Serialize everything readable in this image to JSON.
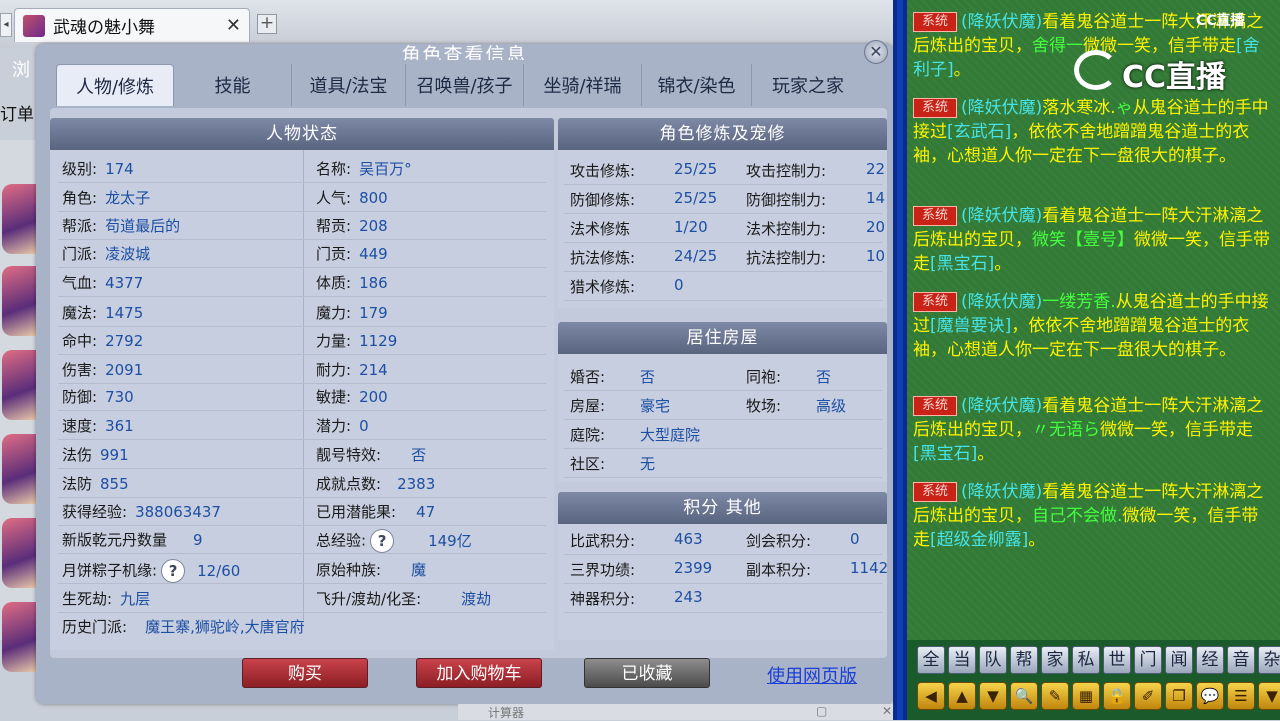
{
  "browser": {
    "tab_title": "武魂の魅小舞",
    "tab_close": "✕",
    "new_tab": "+",
    "menu_glyph": "浏",
    "order_text": "订单"
  },
  "dialog": {
    "title": "角色查看信息",
    "close": "✕",
    "tabs": [
      "人物/修炼",
      "技能",
      "道具/法宝",
      "召唤兽/孩子",
      "坐骑/祥瑞",
      "锦衣/染色",
      "玩家之家"
    ],
    "active_tab": 0
  },
  "status": {
    "header": "人物状态",
    "left": [
      {
        "label": "级别:",
        "value": "174"
      },
      {
        "label": "角色:",
        "value": "龙太子"
      },
      {
        "label": "帮派:",
        "value": "苟道最后的"
      },
      {
        "label": "门派:",
        "value": "凌波城"
      },
      {
        "label": "气血:",
        "value": "4377"
      },
      {
        "label": "魔法:",
        "value": "1475"
      },
      {
        "label": "命中:",
        "value": "2792"
      },
      {
        "label": "伤害:",
        "value": "2091"
      },
      {
        "label": "防御:",
        "value": "730"
      },
      {
        "label": "速度:",
        "value": "361"
      },
      {
        "label": "法伤",
        "value": "991"
      },
      {
        "label": "法防",
        "value": "855"
      },
      {
        "label": "获得经验:",
        "value": "388063437"
      },
      {
        "label": "新版乾元丹数量",
        "value": "9"
      },
      {
        "label": "月饼粽子机缘:",
        "value": "12/60"
      },
      {
        "label": "生死劫:",
        "value": "九层"
      }
    ],
    "right": [
      {
        "label": "名称:",
        "value": "吴百万°"
      },
      {
        "label": "人气:",
        "value": "800"
      },
      {
        "label": "帮贡:",
        "value": "208"
      },
      {
        "label": "门贡:",
        "value": "449"
      },
      {
        "label": "体质:",
        "value": "186"
      },
      {
        "label": "魔力:",
        "value": "179"
      },
      {
        "label": "力量:",
        "value": "1129"
      },
      {
        "label": "耐力:",
        "value": "214"
      },
      {
        "label": "敏捷:",
        "value": "200"
      },
      {
        "label": "潜力:",
        "value": "0"
      },
      {
        "label": "靓号特效:",
        "value": "否"
      },
      {
        "label": "成就点数:",
        "value": "2383"
      },
      {
        "label": "已用潜能果:",
        "value": "47"
      },
      {
        "label": "总经验:",
        "value": "149亿"
      },
      {
        "label": "原始种族:",
        "value": "魔"
      },
      {
        "label": "飞升/渡劫/化圣:",
        "value": "渡劫"
      }
    ],
    "history_label": "历史门派:",
    "history_value": "魔王寨,狮驼岭,大唐官府",
    "help_glyph": "?"
  },
  "cultivation": {
    "header": "角色修炼及宠修",
    "rows": [
      {
        "l1": "攻击修炼:",
        "v1": "25/25",
        "l2": "攻击控制力:",
        "v2": "22"
      },
      {
        "l1": "防御修炼:",
        "v1": "25/25",
        "l2": "防御控制力:",
        "v2": "14"
      },
      {
        "l1": "法术修炼",
        "v1": "1/20",
        "l2": "法术控制力:",
        "v2": "20"
      },
      {
        "l1": "抗法修炼:",
        "v1": "24/25",
        "l2": "抗法控制力:",
        "v2": "10"
      },
      {
        "l1": "猎术修炼:",
        "v1": "0",
        "l2": "",
        "v2": ""
      }
    ]
  },
  "housing": {
    "header": "居住房屋",
    "rows": [
      {
        "l1": "婚否:",
        "v1": "否",
        "l2": "同袍:",
        "v2": "否"
      },
      {
        "l1": "房屋:",
        "v1": "豪宅",
        "l2": "牧场:",
        "v2": "高级"
      },
      {
        "l1": "庭院:",
        "v1": "大型庭院",
        "l2": "",
        "v2": ""
      },
      {
        "l1": "社区:",
        "v1": "无",
        "l2": "",
        "v2": ""
      }
    ]
  },
  "points": {
    "header": "积分 其他",
    "rows": [
      {
        "l1": "比武积分:",
        "v1": "463",
        "l2": "剑会积分:",
        "v2": "0"
      },
      {
        "l1": "三界功绩:",
        "v1": "2399",
        "l2": "副本积分:",
        "v2": "1142"
      },
      {
        "l1": "神器积分:",
        "v1": "243",
        "l2": "",
        "v2": ""
      }
    ]
  },
  "footer": {
    "buy": "购买",
    "add_cart": "加入购物车",
    "favorited": "已收藏",
    "web_link": "使用网页版"
  },
  "calc_bar": {
    "title": "计算器",
    "min": "▢",
    "close": "✕"
  },
  "chat": {
    "watermark_small": "CC直播",
    "watermark": "CC直播",
    "sys_tag": "系统",
    "messages": [
      {
        "a": "(降妖伏魔)",
        "b": "看着鬼谷道士一阵大汗淋漓之后炼出的宝贝，",
        "c": "舍得一",
        "d": "微微一笑，信手带走",
        "e": "[舍利子]",
        "f": "。"
      },
      {
        "a": "(降妖伏魔)",
        "b": "落水寒冰.",
        "c": "ゃ",
        "d": "从鬼谷道士的手中接过",
        "e": "[玄武石]",
        "f": "，依依不舍地蹭蹭鬼谷道士的衣袖，心想道人你一定在下一盘很大的棋子。"
      },
      {
        "a": "(降妖伏魔)",
        "b": "看着鬼谷道士一阵大汗淋漓之后炼出的宝贝，",
        "c": "微笑【壹号】",
        "d": "微微一笑，信手带走",
        "e": "[黑宝石]",
        "f": "。"
      },
      {
        "a": "(降妖伏魔)",
        "b": "",
        "c": "一缕芳香.",
        "d": "从鬼谷道士的手中接过",
        "e": "[魔兽要诀]",
        "f": "，依依不舍地蹭蹭鬼谷道士的衣袖，心想道人你一定在下一盘很大的棋子。"
      },
      {
        "a": "(降妖伏魔)",
        "b": "看着鬼谷道士一阵大汗淋漓之后炼出的宝贝，",
        "c": "〃无语ら",
        "d": "微微一笑，信手带走",
        "e": "[黑宝石]",
        "f": "。"
      },
      {
        "a": "(降妖伏魔)",
        "b": "看着鬼谷道士一阵大汗淋漓之后炼出的宝贝，",
        "c": "自己不会做.",
        "d": "微微一笑，信手带走",
        "e": "[超级金柳露]",
        "f": "。"
      }
    ],
    "channels": [
      "全",
      "当",
      "队",
      "帮",
      "家",
      "私",
      "世",
      "门",
      "闻",
      "经",
      "音",
      "杂"
    ],
    "tool_icons": [
      "arrow-left",
      "arrow-up",
      "arrow-down",
      "search",
      "note",
      "group",
      "lock",
      "brush",
      "copy",
      "speech",
      "list",
      "more"
    ],
    "tool_glyphs": [
      "◀",
      "▲",
      "▼",
      "🔍",
      "✎",
      "▦",
      "🔒",
      "✐",
      "❐",
      "💬",
      "☰",
      "▼"
    ]
  },
  "colors": {
    "chat_bg": "#327a36",
    "chat_text": "#fff300",
    "chat_cyan": "#47e3e8",
    "chat_green": "#45ff3f",
    "value_blue": "#1d4fa3",
    "buy_red": "#c9434b",
    "link_blue": "#1b3fd6"
  }
}
